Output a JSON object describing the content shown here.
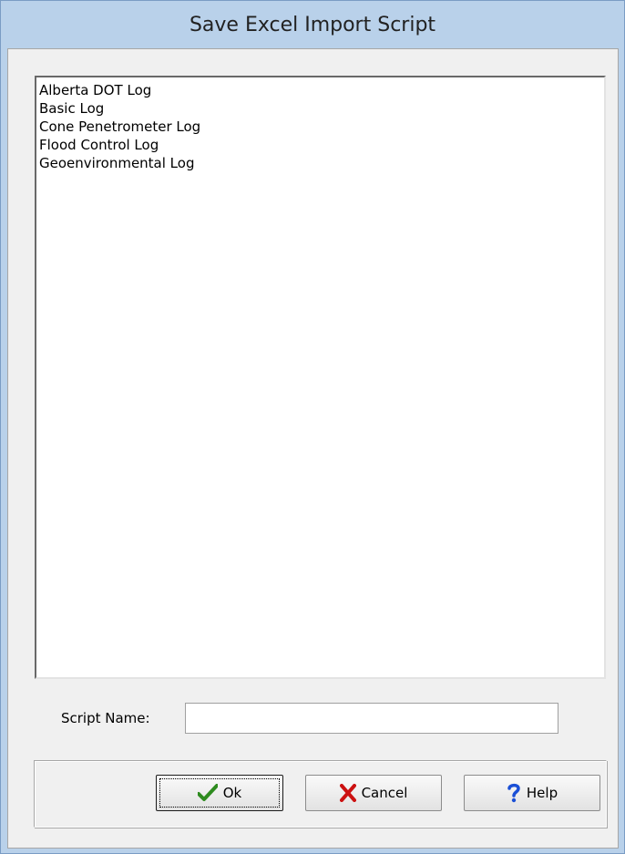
{
  "window": {
    "title": "Save Excel Import Script"
  },
  "script_list": {
    "items": [
      "Alberta DOT Log",
      "Basic Log",
      "Cone Penetrometer Log",
      "Flood Control Log",
      "Geoenvironmental Log"
    ]
  },
  "script_name": {
    "label": "Script Name:",
    "value": ""
  },
  "buttons": {
    "ok_label": "Ok",
    "cancel_label": "Cancel",
    "help_label": "Help"
  },
  "icons": {
    "ok": "checkmark-icon",
    "cancel": "x-icon",
    "help": "question-mark-icon"
  },
  "colors": {
    "window_frame": "#b9d1ea",
    "dialog_background": "#f0f0f0",
    "ok_check": "#2e8b1f",
    "cancel_x": "#cc1111",
    "help_question": "#1a4fd6"
  }
}
